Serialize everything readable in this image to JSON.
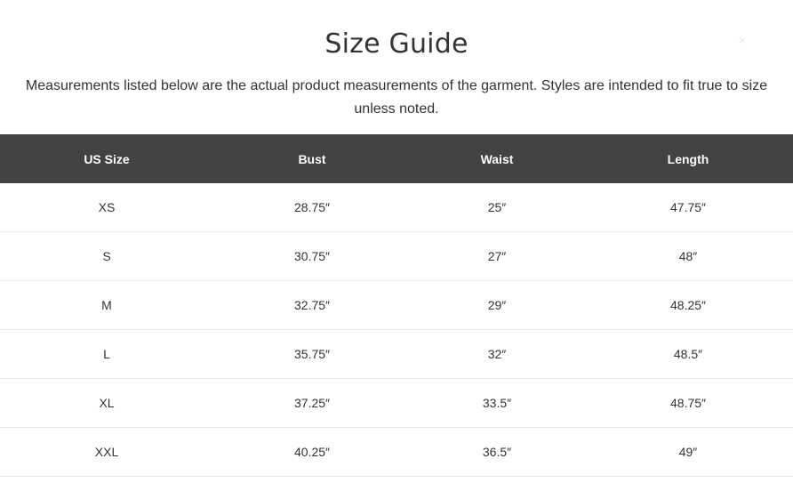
{
  "modal": {
    "title": "Size Guide",
    "description": "Measurements listed below are the actual product measurements of the garment. Styles are intended to fit true to size unless noted.",
    "close_icon": "×"
  },
  "table": {
    "headers": [
      "US Size",
      "Bust",
      "Waist",
      "Length"
    ],
    "rows": [
      [
        "XS",
        "28.75″",
        "25″",
        "47.75″"
      ],
      [
        "S",
        "30.75″",
        "27″",
        "48″"
      ],
      [
        "M",
        "32.75″",
        "29″",
        "48.25″"
      ],
      [
        "L",
        "35.75″",
        "32″",
        "48.5″"
      ],
      [
        "XL",
        "37.25″",
        "33.5″",
        "48.75″"
      ],
      [
        "XXL",
        "40.25″",
        "36.5″",
        "49″"
      ]
    ]
  },
  "colors": {
    "header_bg": "#424242",
    "header_text": "#ffffff",
    "text": "#333333",
    "row_border": "#e6e6e6"
  }
}
